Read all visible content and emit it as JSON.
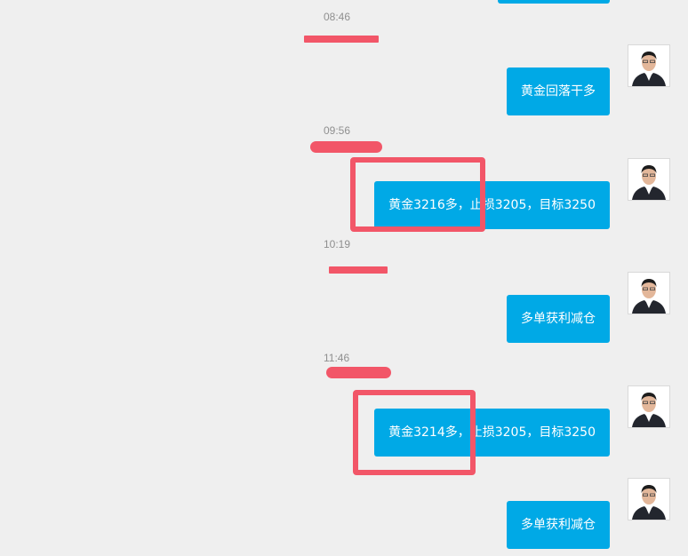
{
  "messages": [
    {
      "time": "08:46",
      "text": "黄金回落干多"
    },
    {
      "time": "09:56",
      "text": "黄金3216多，止损3205，目标3250"
    },
    {
      "time": "10:19",
      "text": "多单获利减仓"
    },
    {
      "time": "11:46",
      "text": "黄金3214多，止损3205，目标3250"
    },
    {
      "time": "",
      "text": "多单获利减仓"
    }
  ],
  "colors": {
    "bubble": "#00a9e6",
    "background": "#efefef",
    "annotation": "#f25668",
    "timestamp": "#8f8f8f"
  },
  "icons": {
    "avatar": "user-photo-icon"
  }
}
